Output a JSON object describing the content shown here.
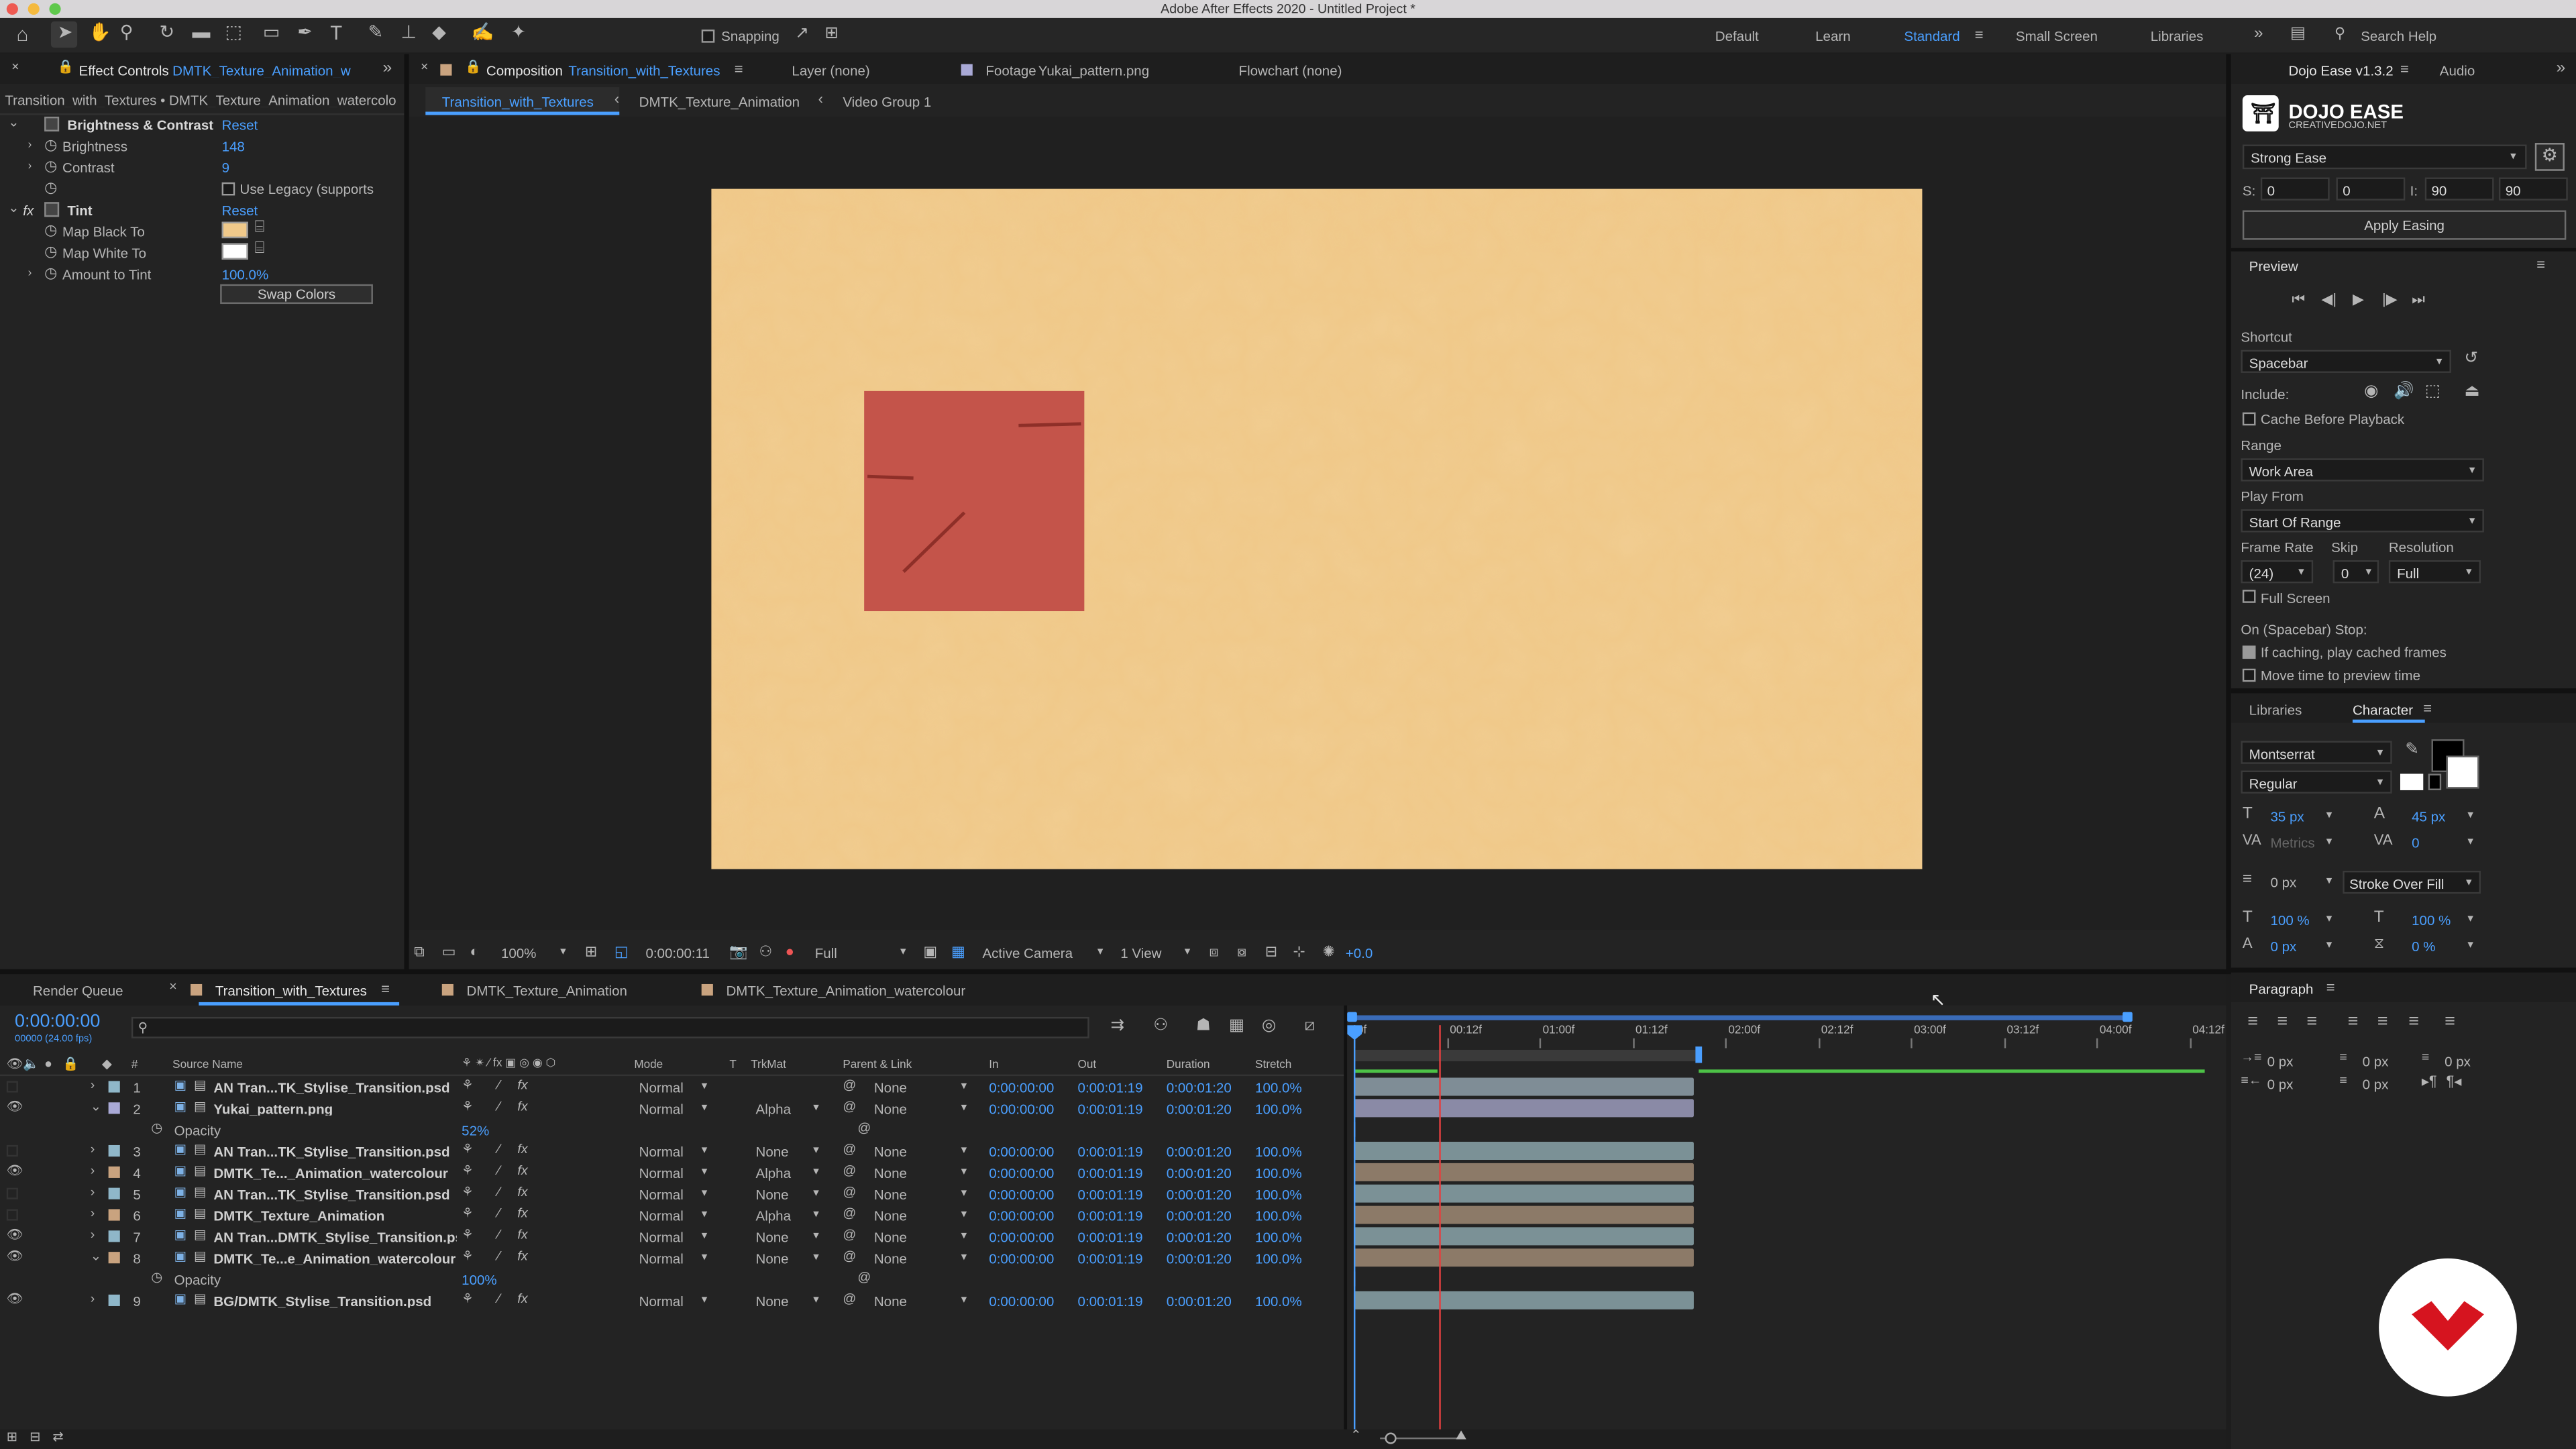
{
  "app": {
    "title": "Adobe After Effects 2020 - Untitled Project *"
  },
  "toolbar": {
    "snapping": "Snapping",
    "workspaces": [
      "Default",
      "Learn",
      "Standard",
      "Small Screen",
      "Libraries"
    ],
    "active_workspace": "Standard",
    "search_placeholder": "Search Help"
  },
  "effect_controls": {
    "tab": "Effect Controls",
    "tab_layer": "DMTK_Texture_Animation_w",
    "breadcrumb": "Transition_with_Textures • DMTK_Texture_Animation_watercolo",
    "bc": {
      "name": "Brightness & Contrast",
      "reset": "Reset",
      "brightness_label": "Brightness",
      "brightness": "148",
      "contrast_label": "Contrast",
      "contrast": "9",
      "legacy": "Use Legacy (supports"
    },
    "tint": {
      "fx": "fx",
      "name": "Tint",
      "reset": "Reset",
      "black": "Map Black To",
      "white": "Map White To",
      "amount_label": "Amount to Tint",
      "amount": "100.0%",
      "swap": "Swap Colors"
    }
  },
  "composition": {
    "tab_prefix": "Composition",
    "tab_name": "Transition_with_Textures",
    "layer_tab": "Layer (none)",
    "footage_prefix": "Footage",
    "footage_name": "Yukai_pattern.png",
    "flowchart": "Flowchart (none)",
    "crumbs": [
      "Transition_with_Textures",
      "DMTK_Texture_Animation",
      "Video Group 1"
    ],
    "footer": {
      "zoom": "100%",
      "time": "0:00:00:11",
      "resolution": "Full",
      "camera": "Active Camera",
      "view": "1 View",
      "exposure": "+0.0"
    },
    "canvas_color": "#f0c98a",
    "square_color": "#c4544a"
  },
  "dojo": {
    "tab": "Dojo Ease v1.3.2",
    "audio_tab": "Audio",
    "title": "DOJO EASE",
    "subtitle": "CREATIVEDOJO.NET",
    "preset": "Strong Ease",
    "s_label": "S:",
    "s_vals": [
      "0",
      "0"
    ],
    "i_label": "I:",
    "i_vals": [
      "90",
      "90"
    ],
    "apply": "Apply Easing"
  },
  "preview": {
    "title": "Preview",
    "shortcut_label": "Shortcut",
    "shortcut": "Spacebar",
    "include": "Include:",
    "cache": "Cache Before Playback",
    "range_label": "Range",
    "range": "Work Area",
    "playfrom_label": "Play From",
    "playfrom": "Start Of Range",
    "framerate_label": "Frame Rate",
    "skip_label": "Skip",
    "resolution_label": "Resolution",
    "framerate": "(24)",
    "skip": "0",
    "resolution": "Full",
    "fullscreen": "Full Screen",
    "stop_label": "On (Spacebar) Stop:",
    "if_caching": "If caching, play cached frames",
    "move_time": "Move time to preview time"
  },
  "character": {
    "libraries_tab": "Libraries",
    "tab": "Character",
    "font": "Montserrat",
    "style": "Regular",
    "size": "35 px",
    "leading": "45 px",
    "kerning": "Metrics",
    "tracking": "0",
    "stroke": "0 px",
    "stroke_mode": "Stroke Over Fill",
    "vscale": "100 %",
    "hscale": "100 %",
    "baseline": "0 px",
    "tsume": "0 %"
  },
  "paragraph": {
    "tab": "Paragraph",
    "vals": [
      "0 px",
      "0 px",
      "0 px",
      "0 px",
      "0 px"
    ]
  },
  "timeline": {
    "tabs": [
      "Render Queue",
      "Transition_with_Textures",
      "DMTK_Texture_Animation",
      "DMTK_Texture_Animation_watercolour"
    ],
    "timecode": "0:00:00:00",
    "fps": "00000 (24.00 fps)",
    "headers": {
      "source": "Source Name",
      "mode": "Mode",
      "t": "T",
      "trkmat": "TrkMat",
      "parent": "Parent & Link",
      "in": "In",
      "out": "Out",
      "duration": "Duration",
      "stretch": "Stretch"
    },
    "ruler": [
      "0f",
      "00:12f",
      "01:00f",
      "01:12f",
      "02:00f",
      "02:12f",
      "03:00f",
      "03:12f",
      "04:00f",
      "04:12f"
    ],
    "layers": [
      {
        "num": "1",
        "name": "AN Tran...TK_Stylise_Transition.psd",
        "mode": "Normal",
        "trkmat": "",
        "parent": "None",
        "in": "0:00:00:00",
        "out": "0:00:01:19",
        "dur": "0:00:01:20",
        "stretch": "100.0%",
        "label": "#8fb7c9",
        "eye": false,
        "bar": "#7f8d96"
      },
      {
        "num": "2",
        "name": "Yukai_pattern.png",
        "mode": "Normal",
        "trkmat": "Alpha",
        "parent": "None",
        "in": "0:00:00:00",
        "out": "0:00:01:19",
        "dur": "0:00:01:20",
        "stretch": "100.0%",
        "label": "#a9a9d6",
        "eye": true,
        "bar": "#8a8aa6",
        "prop": "Opacity",
        "propval": "52%"
      },
      {
        "num": "3",
        "name": "AN Tran...TK_Stylise_Transition.psd",
        "mode": "Normal",
        "trkmat": "None",
        "parent": "None",
        "in": "0:00:00:00",
        "out": "0:00:01:19",
        "dur": "0:00:01:20",
        "stretch": "100.0%",
        "label": "#8fb7c9",
        "eye": false,
        "bar": "#7b9196"
      },
      {
        "num": "4",
        "name": "DMTK_Te..._Animation_watercolour",
        "mode": "Normal",
        "trkmat": "Alpha",
        "parent": "None",
        "in": "0:00:00:00",
        "out": "0:00:01:19",
        "dur": "0:00:01:20",
        "stretch": "100.0%",
        "label": "#c9a37f",
        "eye": true,
        "bar": "#8c7a68"
      },
      {
        "num": "5",
        "name": "AN Tran...TK_Stylise_Transition.psd",
        "mode": "Normal",
        "trkmat": "None",
        "parent": "None",
        "in": "0:00:00:00",
        "out": "0:00:01:19",
        "dur": "0:00:01:20",
        "stretch": "100.0%",
        "label": "#8fb7c9",
        "eye": false,
        "bar": "#7b9196"
      },
      {
        "num": "6",
        "name": "DMTK_Texture_Animation",
        "mode": "Normal",
        "trkmat": "Alpha",
        "parent": "None",
        "in": "0:00:00:00",
        "out": "0:00:01:19",
        "dur": "0:00:01:20",
        "stretch": "100.0%",
        "label": "#c9a37f",
        "eye": false,
        "bar": "#8c7a68"
      },
      {
        "num": "7",
        "name": "AN Tran...DMTK_Stylise_Transition.psd",
        "mode": "Normal",
        "trkmat": "None",
        "parent": "None",
        "in": "0:00:00:00",
        "out": "0:00:01:19",
        "dur": "0:00:01:20",
        "stretch": "100.0%",
        "label": "#8fb7c9",
        "eye": true,
        "bar": "#7b9196"
      },
      {
        "num": "8",
        "name": "DMTK_Te...e_Animation_watercolour",
        "mode": "Normal",
        "trkmat": "None",
        "parent": "None",
        "in": "0:00:00:00",
        "out": "0:00:01:19",
        "dur": "0:00:01:20",
        "stretch": "100.0%",
        "label": "#c9a37f",
        "eye": true,
        "bar": "#8c7a68",
        "prop": "Opacity",
        "propval": "100%"
      },
      {
        "num": "9",
        "name": "BG/DMTK_Stylise_Transition.psd",
        "mode": "Normal",
        "trkmat": "None",
        "parent": "None",
        "in": "0:00:00:00",
        "out": "0:00:01:19",
        "dur": "0:00:01:20",
        "stretch": "100.0%",
        "label": "#8fb7c9",
        "eye": true,
        "bar": "#7b9196"
      }
    ]
  }
}
